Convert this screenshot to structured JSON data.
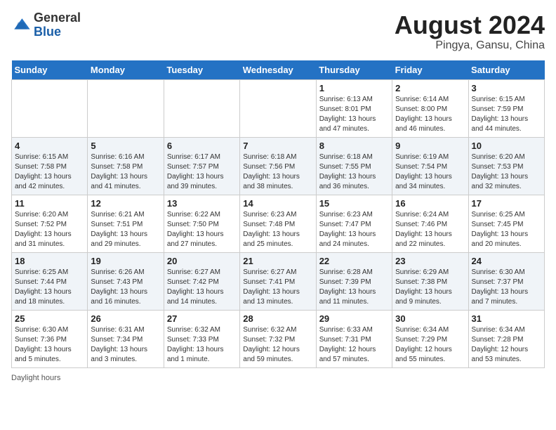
{
  "header": {
    "logo_general": "General",
    "logo_blue": "Blue",
    "title": "August 2024",
    "subtitle": "Pingya, Gansu, China"
  },
  "days_of_week": [
    "Sunday",
    "Monday",
    "Tuesday",
    "Wednesday",
    "Thursday",
    "Friday",
    "Saturday"
  ],
  "weeks": [
    [
      {
        "day": "",
        "info": ""
      },
      {
        "day": "",
        "info": ""
      },
      {
        "day": "",
        "info": ""
      },
      {
        "day": "",
        "info": ""
      },
      {
        "day": "1",
        "info": "Sunrise: 6:13 AM\nSunset: 8:01 PM\nDaylight: 13 hours\nand 47 minutes."
      },
      {
        "day": "2",
        "info": "Sunrise: 6:14 AM\nSunset: 8:00 PM\nDaylight: 13 hours\nand 46 minutes."
      },
      {
        "day": "3",
        "info": "Sunrise: 6:15 AM\nSunset: 7:59 PM\nDaylight: 13 hours\nand 44 minutes."
      }
    ],
    [
      {
        "day": "4",
        "info": "Sunrise: 6:15 AM\nSunset: 7:58 PM\nDaylight: 13 hours\nand 42 minutes."
      },
      {
        "day": "5",
        "info": "Sunrise: 6:16 AM\nSunset: 7:58 PM\nDaylight: 13 hours\nand 41 minutes."
      },
      {
        "day": "6",
        "info": "Sunrise: 6:17 AM\nSunset: 7:57 PM\nDaylight: 13 hours\nand 39 minutes."
      },
      {
        "day": "7",
        "info": "Sunrise: 6:18 AM\nSunset: 7:56 PM\nDaylight: 13 hours\nand 38 minutes."
      },
      {
        "day": "8",
        "info": "Sunrise: 6:18 AM\nSunset: 7:55 PM\nDaylight: 13 hours\nand 36 minutes."
      },
      {
        "day": "9",
        "info": "Sunrise: 6:19 AM\nSunset: 7:54 PM\nDaylight: 13 hours\nand 34 minutes."
      },
      {
        "day": "10",
        "info": "Sunrise: 6:20 AM\nSunset: 7:53 PM\nDaylight: 13 hours\nand 32 minutes."
      }
    ],
    [
      {
        "day": "11",
        "info": "Sunrise: 6:20 AM\nSunset: 7:52 PM\nDaylight: 13 hours\nand 31 minutes."
      },
      {
        "day": "12",
        "info": "Sunrise: 6:21 AM\nSunset: 7:51 PM\nDaylight: 13 hours\nand 29 minutes."
      },
      {
        "day": "13",
        "info": "Sunrise: 6:22 AM\nSunset: 7:50 PM\nDaylight: 13 hours\nand 27 minutes."
      },
      {
        "day": "14",
        "info": "Sunrise: 6:23 AM\nSunset: 7:48 PM\nDaylight: 13 hours\nand 25 minutes."
      },
      {
        "day": "15",
        "info": "Sunrise: 6:23 AM\nSunset: 7:47 PM\nDaylight: 13 hours\nand 24 minutes."
      },
      {
        "day": "16",
        "info": "Sunrise: 6:24 AM\nSunset: 7:46 PM\nDaylight: 13 hours\nand 22 minutes."
      },
      {
        "day": "17",
        "info": "Sunrise: 6:25 AM\nSunset: 7:45 PM\nDaylight: 13 hours\nand 20 minutes."
      }
    ],
    [
      {
        "day": "18",
        "info": "Sunrise: 6:25 AM\nSunset: 7:44 PM\nDaylight: 13 hours\nand 18 minutes."
      },
      {
        "day": "19",
        "info": "Sunrise: 6:26 AM\nSunset: 7:43 PM\nDaylight: 13 hours\nand 16 minutes."
      },
      {
        "day": "20",
        "info": "Sunrise: 6:27 AM\nSunset: 7:42 PM\nDaylight: 13 hours\nand 14 minutes."
      },
      {
        "day": "21",
        "info": "Sunrise: 6:27 AM\nSunset: 7:41 PM\nDaylight: 13 hours\nand 13 minutes."
      },
      {
        "day": "22",
        "info": "Sunrise: 6:28 AM\nSunset: 7:39 PM\nDaylight: 13 hours\nand 11 minutes."
      },
      {
        "day": "23",
        "info": "Sunrise: 6:29 AM\nSunset: 7:38 PM\nDaylight: 13 hours\nand 9 minutes."
      },
      {
        "day": "24",
        "info": "Sunrise: 6:30 AM\nSunset: 7:37 PM\nDaylight: 13 hours\nand 7 minutes."
      }
    ],
    [
      {
        "day": "25",
        "info": "Sunrise: 6:30 AM\nSunset: 7:36 PM\nDaylight: 13 hours\nand 5 minutes."
      },
      {
        "day": "26",
        "info": "Sunrise: 6:31 AM\nSunset: 7:34 PM\nDaylight: 13 hours\nand 3 minutes."
      },
      {
        "day": "27",
        "info": "Sunrise: 6:32 AM\nSunset: 7:33 PM\nDaylight: 13 hours\nand 1 minute."
      },
      {
        "day": "28",
        "info": "Sunrise: 6:32 AM\nSunset: 7:32 PM\nDaylight: 12 hours\nand 59 minutes."
      },
      {
        "day": "29",
        "info": "Sunrise: 6:33 AM\nSunset: 7:31 PM\nDaylight: 12 hours\nand 57 minutes."
      },
      {
        "day": "30",
        "info": "Sunrise: 6:34 AM\nSunset: 7:29 PM\nDaylight: 12 hours\nand 55 minutes."
      },
      {
        "day": "31",
        "info": "Sunrise: 6:34 AM\nSunset: 7:28 PM\nDaylight: 12 hours\nand 53 minutes."
      }
    ]
  ],
  "footer": {
    "daylight_label": "Daylight hours"
  }
}
